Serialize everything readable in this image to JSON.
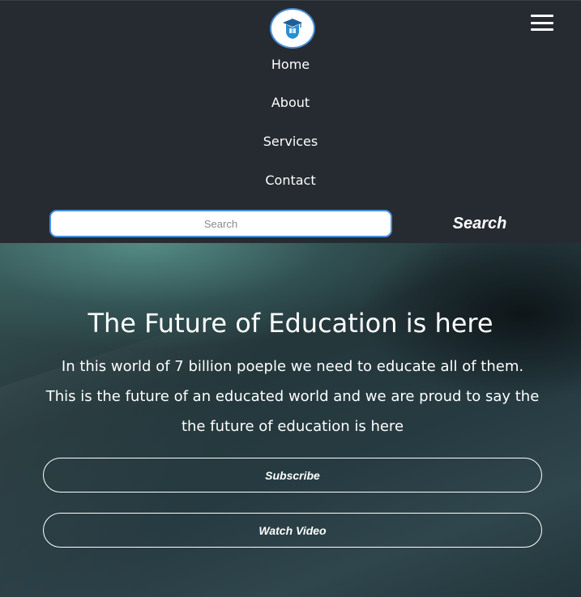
{
  "header": {
    "logo_icon": "graduation-shield-icon",
    "menu_icon": "hamburger-menu-icon"
  },
  "nav": {
    "items": [
      {
        "label": "Home"
      },
      {
        "label": "About"
      },
      {
        "label": "Services"
      },
      {
        "label": "Contact"
      }
    ]
  },
  "search": {
    "placeholder": "Search",
    "value": "",
    "button_label": "Search"
  },
  "hero": {
    "title": "The Future of Education is here",
    "text": "In this world of 7 billion poeple we need to educate all of them. This is the future of an educated world and we are proud to say the the future of education is here",
    "buttons": [
      {
        "label": "Subscribe"
      },
      {
        "label": "Watch Video"
      }
    ]
  },
  "colors": {
    "navbar_bg": "#262b31",
    "accent": "#4a90e2",
    "text": "#ffffff"
  }
}
